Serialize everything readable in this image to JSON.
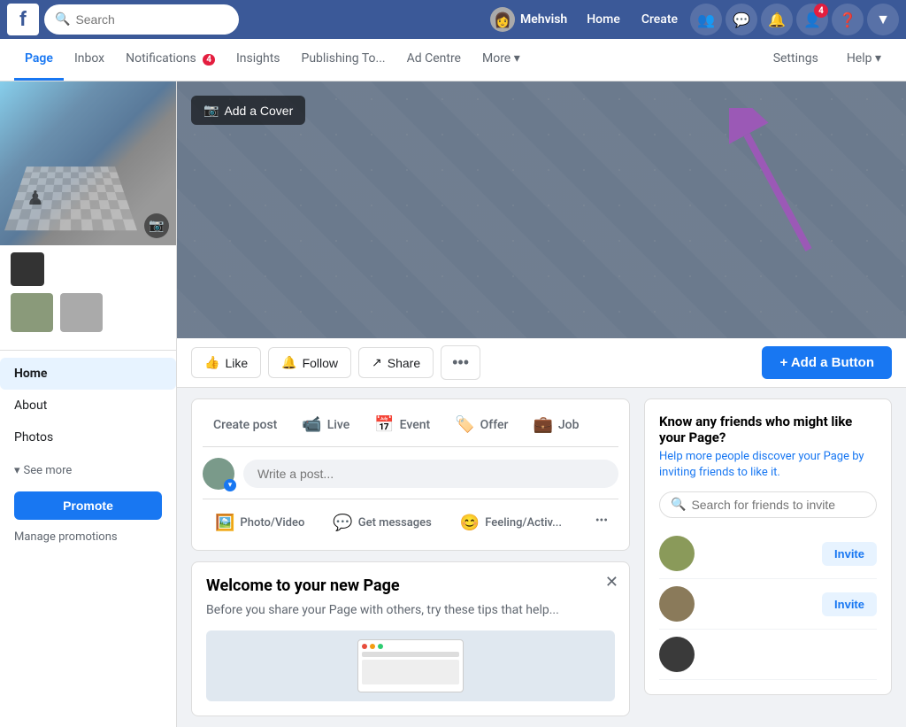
{
  "brand": {
    "logo_letter": "f"
  },
  "top_nav": {
    "search_placeholder": "Search",
    "user_name": "Mehvish",
    "links": [
      "Home",
      "Create"
    ],
    "icons": {
      "friends": "👥",
      "messenger": "💬",
      "notifications": "🔔",
      "friend_requests": "👤",
      "help": "❓",
      "dropdown": "▼"
    },
    "notification_badge": "4"
  },
  "page_tabs": {
    "tabs": [
      "Page",
      "Inbox",
      "Notifications",
      "Insights",
      "Publishing To...",
      "Ad Centre",
      "More"
    ],
    "active": "Page",
    "notifications_badge": "4",
    "right_tabs": [
      "Settings",
      "Help"
    ]
  },
  "sidebar": {
    "nav_items": [
      {
        "label": "Home",
        "active": true
      },
      {
        "label": "About"
      },
      {
        "label": "Photos"
      }
    ],
    "see_more": "See more",
    "promote_label": "Promote",
    "manage_promotions": "Manage promotions"
  },
  "cover": {
    "add_cover_label": "Add a Cover",
    "camera_icon": "📷"
  },
  "action_bar": {
    "like_label": "Like",
    "follow_label": "Follow",
    "share_label": "Share",
    "more_icon": "•••",
    "add_button_label": "+ Add a Button"
  },
  "create_post": {
    "post_types": [
      {
        "label": "Create post"
      },
      {
        "icon": "📹",
        "label": "Live",
        "color": "#e41e3f"
      },
      {
        "icon": "📅",
        "label": "Event",
        "color": "#1877f2"
      },
      {
        "icon": "🏷️",
        "label": "Offer",
        "color": "#e67e22"
      },
      {
        "icon": "💼",
        "label": "Job",
        "color": "#27ae60"
      }
    ],
    "write_placeholder": "Write a post...",
    "actions": [
      {
        "icon": "🖼️",
        "label": "Photo/Video"
      },
      {
        "icon": "💬",
        "label": "Get messages"
      },
      {
        "icon": "😊",
        "label": "Feeling/Activ..."
      }
    ]
  },
  "welcome": {
    "title": "Welcome to your new Page",
    "text": "Before you share your Page with others, try these tips that help..."
  },
  "invite_panel": {
    "title": "Know any friends who might like your Page?",
    "subtitle": "Help more people discover your Page by inviting friends to like it.",
    "search_placeholder": "Search for friends to invite",
    "friends": [
      {
        "color": "green"
      },
      {
        "color": "brown"
      },
      {
        "color": "dark"
      }
    ],
    "invite_label": "Invite"
  }
}
